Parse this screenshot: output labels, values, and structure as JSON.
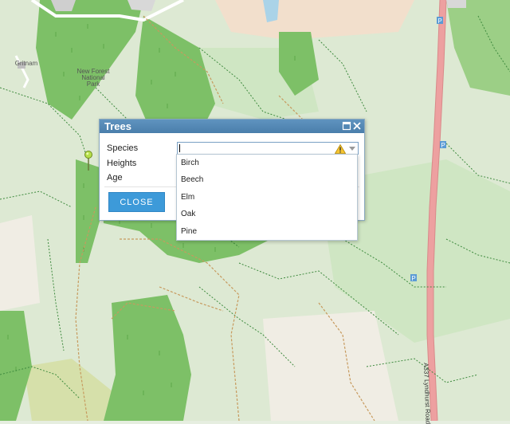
{
  "map": {
    "labels": {
      "park": "New Forest National Park",
      "place": "Gritnam",
      "road": "A337 Lyndhurst Road"
    },
    "colors": {
      "background": "#e6eee0",
      "woodland": "#7dc067",
      "light_green": "#cfe6c3",
      "main_road": "#e88f8f",
      "heath": "#f2dfcc"
    }
  },
  "panel": {
    "title": "Trees",
    "fields": {
      "species_label": "Species",
      "heights_label": "Heights",
      "age_label": "Age"
    },
    "species_value": "",
    "close_label": "CLOSE",
    "icons": {
      "maximize": "maximize-icon",
      "close": "close-x-icon",
      "warning": "warning-icon",
      "dropdown": "chevron-down-icon"
    }
  },
  "dropdown": {
    "options": [
      "Birch",
      "Beech",
      "Elm",
      "Oak",
      "Pine"
    ]
  }
}
